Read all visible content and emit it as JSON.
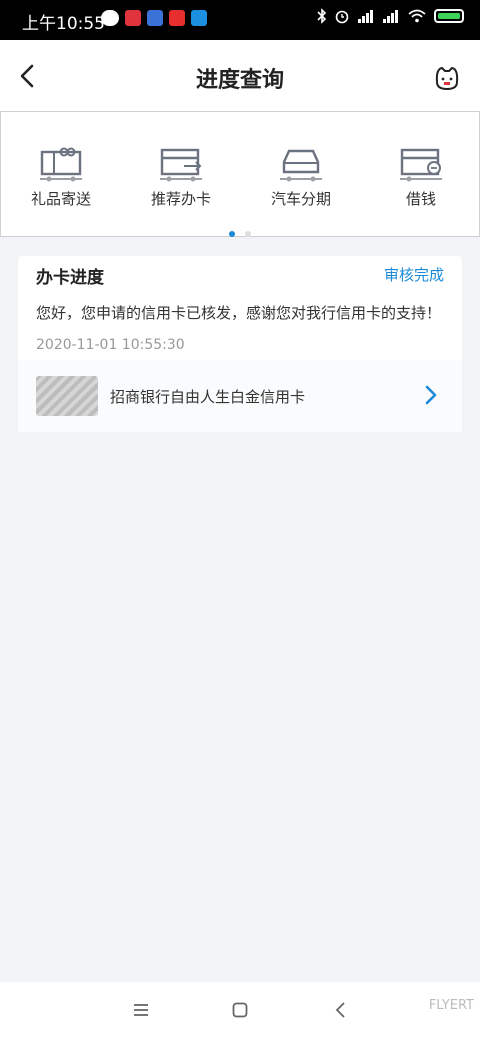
{
  "status_bar": {
    "time": "上午10:55",
    "icons": [
      "wechat-icon",
      "app-icon-red",
      "app-icon-blue",
      "app-icon-c",
      "app-icon-flight"
    ],
    "system_icons": [
      "bluetooth-icon",
      "alarm-icon",
      "signal-icon",
      "signal-hd-icon",
      "wifi-icon",
      "battery-charging-icon"
    ]
  },
  "header": {
    "title": "进度查询",
    "back_icon": "chevron-left-icon",
    "service_icon": "customer-service-icon"
  },
  "quick_actions": [
    {
      "label": "礼品寄送",
      "icon": "gift-icon"
    },
    {
      "label": "推荐办卡",
      "icon": "recommend-card-icon"
    },
    {
      "label": "汽车分期",
      "icon": "car-icon"
    },
    {
      "label": "借钱",
      "icon": "loan-icon"
    }
  ],
  "pager": {
    "active": 1,
    "total": 2
  },
  "progress_card": {
    "title": "办卡进度",
    "status": "审核完成",
    "message": "您好，您申请的信用卡已核发，感谢您对我行信用卡的支持！",
    "timestamp": "2020-11-01 10:55:30",
    "card_name": "招商银行自由人生白金信用卡"
  },
  "colors": {
    "accent": "#1a8ad8",
    "background": "#f2f3f7"
  }
}
